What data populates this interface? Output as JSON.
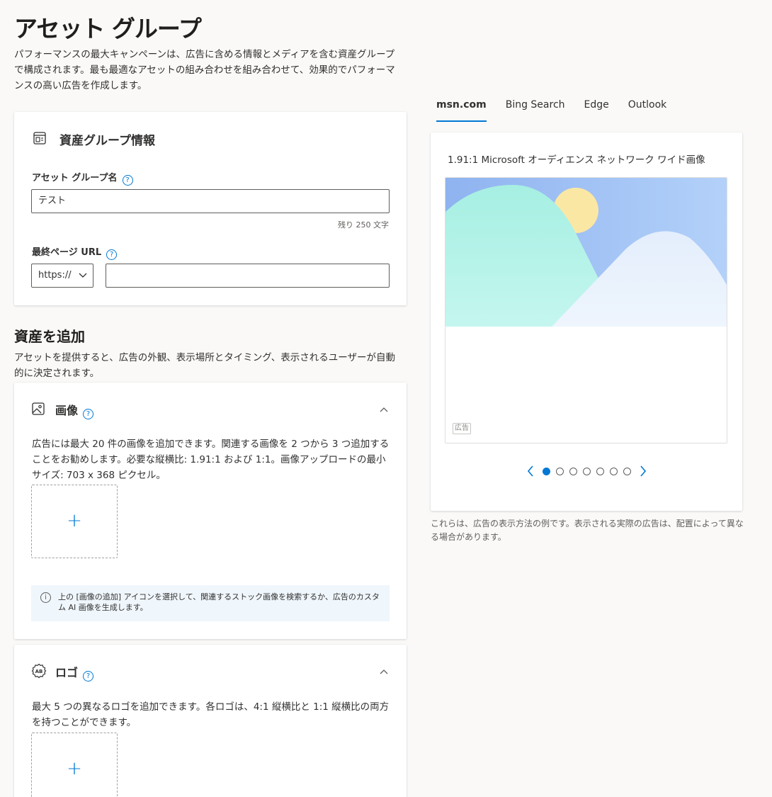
{
  "page": {
    "title": "アセット グループ",
    "description": "パフォーマンスの最大キャンペーンは、広告に含める情報とメディアを含む資産グループで構成されます。最も最適なアセットの組み合わせを組み合わせて、効果的でパフォーマンスの高い広告を作成します。"
  },
  "asset_group_info": {
    "title": "資産グループ情報",
    "icon": "form-icon",
    "name_label": "アセット グループ名",
    "name_value": "テスト",
    "char_remaining": "残り 250 文字",
    "url_label": "最終ページ URL",
    "protocol_selected": "https://",
    "url_value": ""
  },
  "add_assets": {
    "title": "資産を追加",
    "description": "アセットを提供すると、広告の外観、表示場所とタイミング、表示されるユーザーが自動的に決定されます。"
  },
  "images_section": {
    "title": "画像",
    "icon": "image-icon",
    "description": "広告には最大 20 件の画像を追加できます。関連する画像を 2 つから 3 つ追加することをお勧めします。必要な縦横比: 1.91:1 および 1:1。画像アップロードの最小サイズ: 703 x 368 ピクセル。",
    "add_symbol": "+",
    "info_text": "上の [画像の追加] アイコンを選択して、関連するストック画像を検索するか、広告のカスタム AI 画像を生成します。"
  },
  "logo_section": {
    "title": "ロゴ",
    "icon": "logo-icon",
    "description": "最大 5 つの異なるロゴを追加できます。各ロゴは、4:1 縦横比と 1:1 縦横比の両方を持つことができます。",
    "add_symbol": "+"
  },
  "preview": {
    "tabs": [
      "msn.com",
      "Bing Search",
      "Edge",
      "Outlook"
    ],
    "active_tab": 0,
    "title": "1.91:1  Microsoft オーディエンス ネットワーク ワイド画像",
    "ad_badge": "広告",
    "carousel_count": 7,
    "carousel_active": 0,
    "note": "これらは、広告の表示方法の例です。表示される実際の広告は、配置によって異なる場合があります。"
  },
  "colors": {
    "accent": "#0078d4",
    "background": "#faf9f8",
    "info_bar": "#eff6fc"
  }
}
